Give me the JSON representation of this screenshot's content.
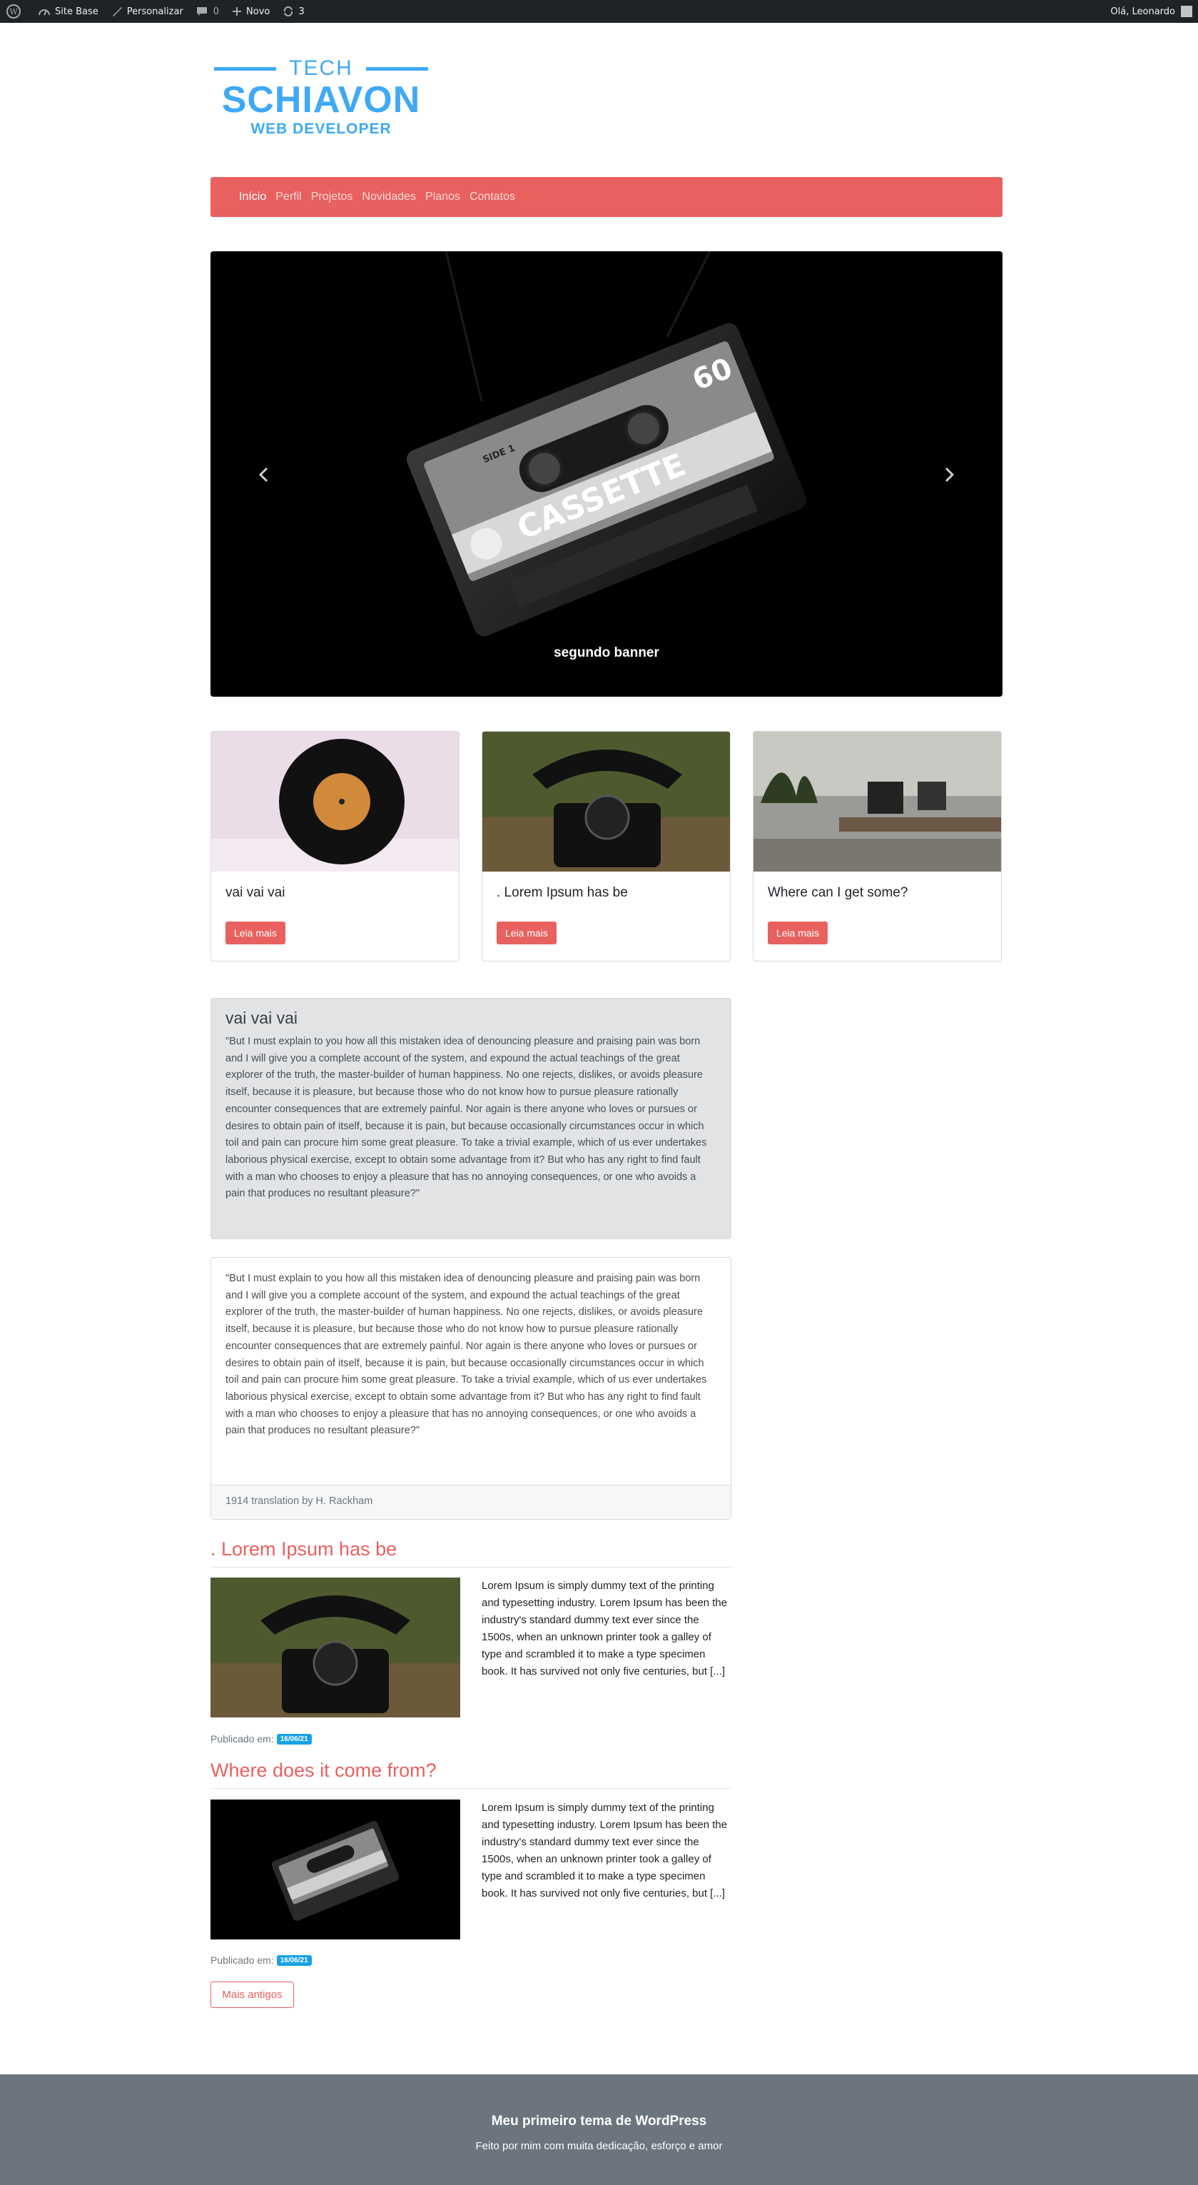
{
  "adminbar": {
    "site_name": "Site Base",
    "customize": "Personalizar",
    "comments_count": "0",
    "new": "Novo",
    "updates_count": "3",
    "greeting": "Olá, Leonardo"
  },
  "logo": {
    "tech": "TECH",
    "name": "SCHIAVON",
    "tagline": "WEB DEVELOPER"
  },
  "nav": {
    "items": [
      "Início",
      "Perfil",
      "Projetos",
      "Novidades",
      "Planos",
      "Contatos"
    ]
  },
  "carousel": {
    "caption": "segundo banner",
    "cassette_side": "SIDE 1",
    "cassette_label": "CASSETTE",
    "cassette_number": "60"
  },
  "cards": [
    {
      "title": "vai vai vai",
      "button": "Leia mais"
    },
    {
      "title": ". Lorem Ipsum has be",
      "button": "Leia mais"
    },
    {
      "title": "Where can I get some?",
      "button": "Leia mais"
    }
  ],
  "jumbotron": {
    "title": "vai vai vai",
    "text": "\"But I must explain to you how all this mistaken idea of denouncing pleasure and praising pain was born and I will give you a complete account of the system, and expound the actual teachings of the great explorer of the truth, the master-builder of human happiness. No one rejects, dislikes, or avoids pleasure itself, because it is pleasure, but because those who do not know how to pursue pleasure rationally encounter consequences that are extremely painful. Nor again is there anyone who loves or pursues or desires to obtain pain of itself, because it is pain, but because occasionally circumstances occur in which toil and pain can procure him some great pleasure. To take a trivial example, which of us ever undertakes laborious physical exercise, except to obtain some advantage from it? But who has any right to find fault with a man who chooses to enjoy a pleasure that has no annoying consequences, or one who avoids a pain that produces no resultant pleasure?\""
  },
  "quotecard": {
    "text": "\"But I must explain to you how all this mistaken idea of denouncing pleasure and praising pain was born and I will give you a complete account of the system, and expound the actual teachings of the great explorer of the truth, the master-builder of human happiness. No one rejects, dislikes, or avoids pleasure itself, because it is pleasure, but because those who do not know how to pursue pleasure rationally encounter consequences that are extremely painful. Nor again is there anyone who loves or pursues or desires to obtain pain of itself, because it is pain, but because occasionally circumstances occur in which toil and pain can procure him some great pleasure. To take a trivial example, which of us ever undertakes laborious physical exercise, except to obtain some advantage from it? But who has any right to find fault with a man who chooses to enjoy a pleasure that has no annoying consequences, or one who avoids a pain that produces no resultant pleasure?\"",
    "footer": "1914 translation by H. Rackham"
  },
  "posts": [
    {
      "title": ". Lorem Ipsum has be",
      "excerpt": "Lorem Ipsum is simply dummy text of the printing and typesetting industry. Lorem Ipsum has been the industry's standard dummy text ever since the 1500s, when an unknown printer took a galley of type and scrambled it to make a type specimen book. It has survived not only five centuries, but [...]",
      "published_label": "Publicado em:",
      "date": "16/06/21"
    },
    {
      "title": "Where does it come from?",
      "excerpt": "Lorem Ipsum is simply dummy text of the printing and typesetting industry. Lorem Ipsum has been the industry's standard dummy text ever since the 1500s, when an unknown printer took a galley of type and scrambled it to make a type specimen book. It has survived not only five centuries, but [...]",
      "published_label": "Publicado em:",
      "date": "16/06/21"
    }
  ],
  "older_button": "Mais antigos",
  "footer": {
    "title": "Meu primeiro tema de WordPress",
    "subtitle": "Feito por mim com muita dedicação, esforço e amor"
  },
  "colors": {
    "accent": "#e8615f",
    "logo_blue": "#3fa9f5",
    "badge_blue": "#17a2e8",
    "footer_gray": "#6c757d",
    "adminbar": "#1d2327"
  }
}
